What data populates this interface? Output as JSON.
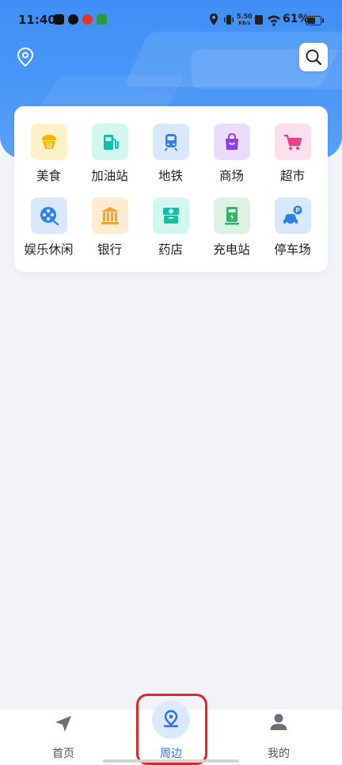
{
  "status_bar": {
    "time": "11:40",
    "network_speed_top": "5.50",
    "network_speed_bottom": "KB/s",
    "battery": "61%"
  },
  "header": {
    "location_icon": "location-pin-icon",
    "search_icon": "search-icon"
  },
  "categories": [
    {
      "label": "美食",
      "icon": "cupcake-icon",
      "bg": "#fdf2c7",
      "color": "#f5b400"
    },
    {
      "label": "加油站",
      "icon": "fuel-pump-icon",
      "bg": "#d3f6ef",
      "color": "#13c1a1"
    },
    {
      "label": "地铁",
      "icon": "metro-train-icon",
      "bg": "#d9e9fb",
      "color": "#2c82e6"
    },
    {
      "label": "商场",
      "icon": "shopping-bag-icon",
      "bg": "#ecdcfb",
      "color": "#8e3ee8"
    },
    {
      "label": "超市",
      "icon": "shopping-cart-icon",
      "bg": "#fde0ec",
      "color": "#ec3f86"
    },
    {
      "label": "娱乐休闲",
      "icon": "film-reel-icon",
      "bg": "#d9e9fb",
      "color": "#2c82e6"
    },
    {
      "label": "银行",
      "icon": "bank-icon",
      "bg": "#fdebd2",
      "color": "#f0a23a"
    },
    {
      "label": "药店",
      "icon": "medicine-box-icon",
      "bg": "#d3f6ef",
      "color": "#13c1a1"
    },
    {
      "label": "充电站",
      "icon": "charging-station-icon",
      "bg": "#dcf3e4",
      "color": "#2db564"
    },
    {
      "label": "停车场",
      "icon": "parking-car-icon",
      "bg": "#d9e9fb",
      "color": "#2c82e6"
    }
  ],
  "tabs": [
    {
      "label": "首页",
      "icon": "navigation-arrow-icon"
    },
    {
      "label": "周边",
      "icon": "nearby-pin-icon",
      "active": true
    },
    {
      "label": "我的",
      "icon": "user-icon"
    }
  ],
  "accent_color": "#2d6fe0",
  "highlight_color": "#e3242b"
}
